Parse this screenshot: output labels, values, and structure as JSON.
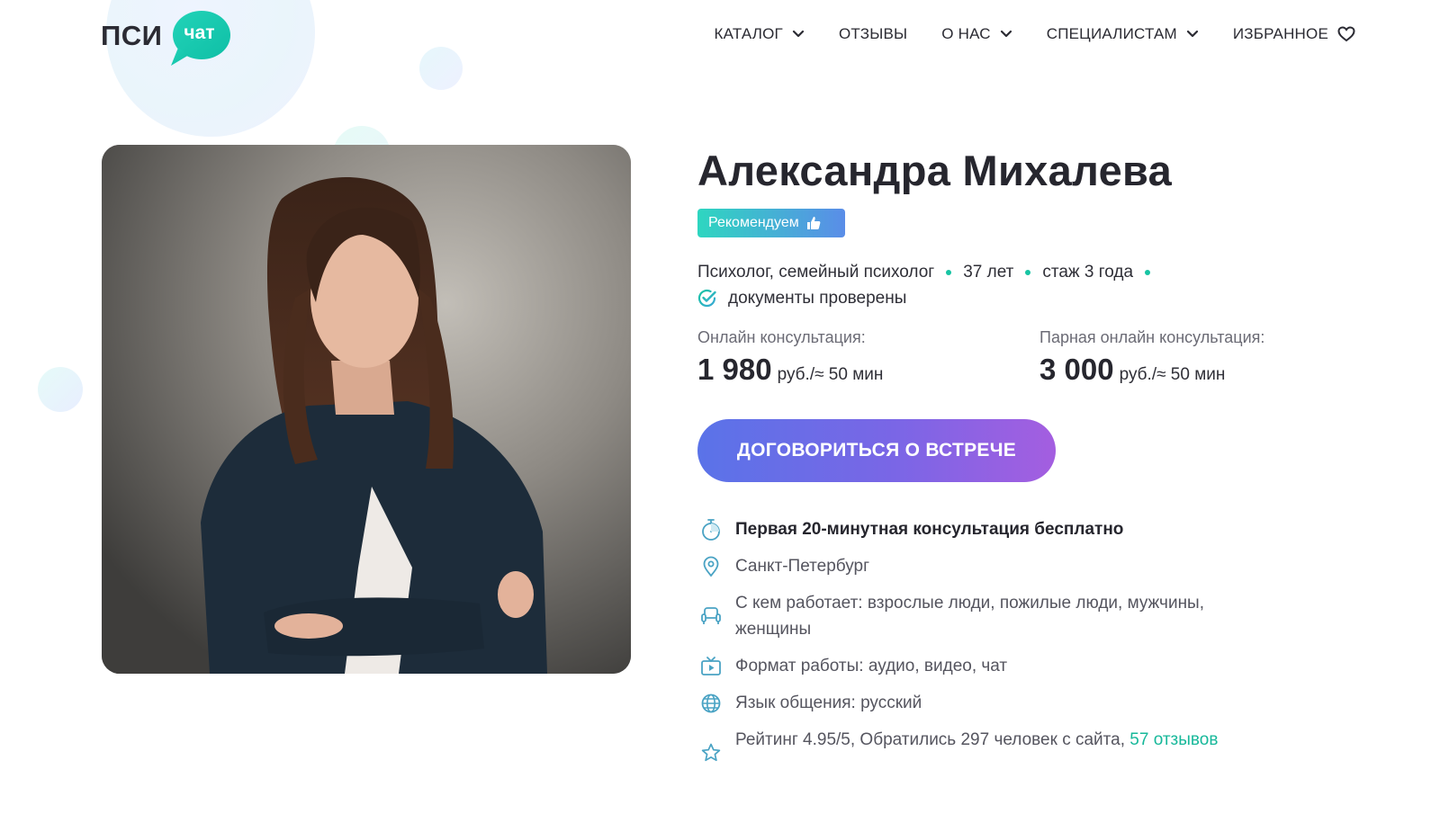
{
  "header": {
    "logo_left": "ПСИ",
    "logo_right": "чат",
    "nav": [
      {
        "label": "КАТАЛОГ",
        "has_dropdown": true
      },
      {
        "label": "ОТЗЫВЫ",
        "has_dropdown": false
      },
      {
        "label": "О НАС",
        "has_dropdown": true
      },
      {
        "label": "СПЕЦИАЛИСТАМ",
        "has_dropdown": true
      },
      {
        "label": "ИЗБРАННОЕ",
        "icon": "heart-icon"
      }
    ]
  },
  "profile": {
    "name": "Александра Михалева",
    "badge": "Рекомендуем",
    "specialty": "Психолог, семейный психолог",
    "age": "37 лет",
    "experience": "стаж 3 года",
    "verified": "документы проверены"
  },
  "prices": {
    "online": {
      "label": "Онлайн консультация:",
      "value": "1 980",
      "unit": "руб./≈ 50 мин"
    },
    "couple": {
      "label": "Парная онлайн консультация:",
      "value": "3 000",
      "unit": "руб./≈ 50 мин"
    }
  },
  "cta_label": "ДОГОВОРИТЬСЯ О ВСТРЕЧЕ",
  "features": {
    "free": "Первая 20-минутная консультация бесплатно",
    "city": "Санкт-Петербург",
    "clients": "С кем работает: взрослые люди, пожилые люди, мужчины, женщины",
    "format": "Формат работы: аудио, видео, чат",
    "language": "Язык общения: русский",
    "rating_text": "Рейтинг 4.95/5, Обратились 297 человек с сайта,",
    "reviews_link": "57 отзывов"
  },
  "colors": {
    "accent": "#17c4a3",
    "cta_start": "#5a73e8",
    "cta_end": "#a45ee0",
    "badge_start": "#2ed6c0",
    "badge_end": "#5a8de8",
    "icon": "#4aa3c4"
  }
}
